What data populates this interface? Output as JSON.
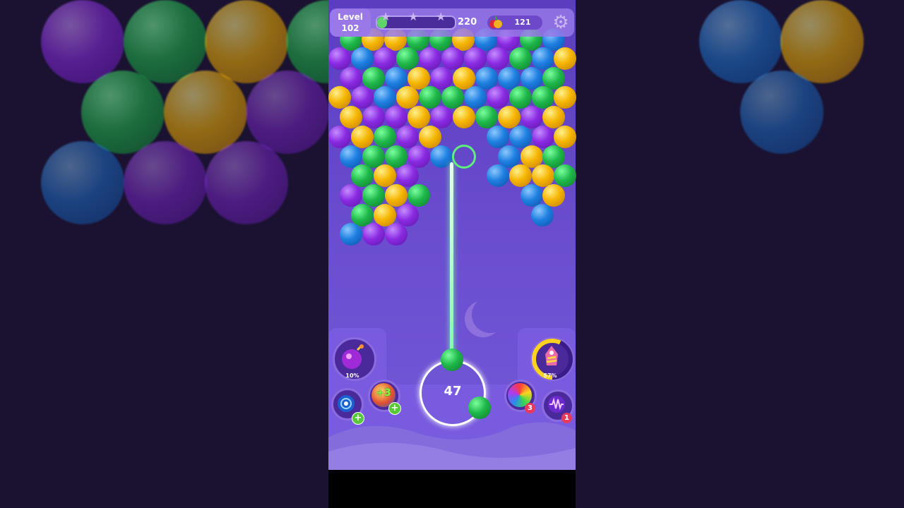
{
  "hud": {
    "level_label": "Level",
    "level_number": "102",
    "score": "220",
    "fruit_count": "121",
    "stars_earned": 0,
    "stars_total": 3,
    "progress_fraction": 0.08
  },
  "boosters": {
    "bomb_percent": "10%",
    "rocket_percent": "57%",
    "extra_balls_label": "+3",
    "rainbow_count": "3",
    "wave_count": "1"
  },
  "shooter": {
    "shots_left": "47",
    "current_ball_color": "green",
    "next_ball_color": "green"
  },
  "colors": {
    "purple": "#8a2be2",
    "green": "#1fb84a",
    "blue": "#1e7fe0",
    "yellow": "#f5b400"
  },
  "icons": [
    "gear-icon",
    "star-icon",
    "fruit-icon",
    "bomb-icon",
    "rocket-icon",
    "target-icon",
    "rainbow-ball-icon",
    "wave-icon"
  ]
}
